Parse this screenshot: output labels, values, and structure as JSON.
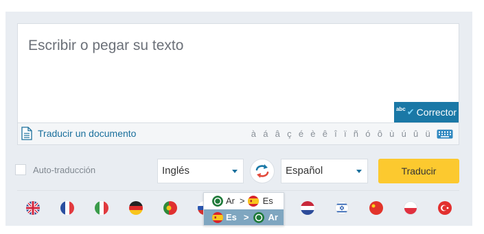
{
  "editor": {
    "placeholder": "Escribir o pegar su texto",
    "corrector": {
      "abc": "abc",
      "label": "Corrector"
    }
  },
  "toolbar": {
    "translate_document": "Traducir un documento",
    "accents": "à á â ç é è ê î ï ñ ó ô ù ú û ü"
  },
  "controls": {
    "auto_translate": "Auto-traducción",
    "source_language": "Inglés",
    "target_language": "Español",
    "translate_button": "Traducir"
  },
  "flags": [
    "uk",
    "france",
    "italy",
    "germany",
    "portugal",
    "russia",
    "netherlands",
    "israel",
    "china",
    "poland",
    "turkey"
  ],
  "popup": {
    "row1": {
      "from": "Ar",
      "sep": ">",
      "to": "Es"
    },
    "row2": {
      "from": "Es",
      "sep": ">",
      "to": "Ar"
    }
  },
  "colors": {
    "accent_blue": "#1a78a6",
    "translate_yellow": "#fcc92f",
    "panel_bg": "#e9edf2"
  }
}
